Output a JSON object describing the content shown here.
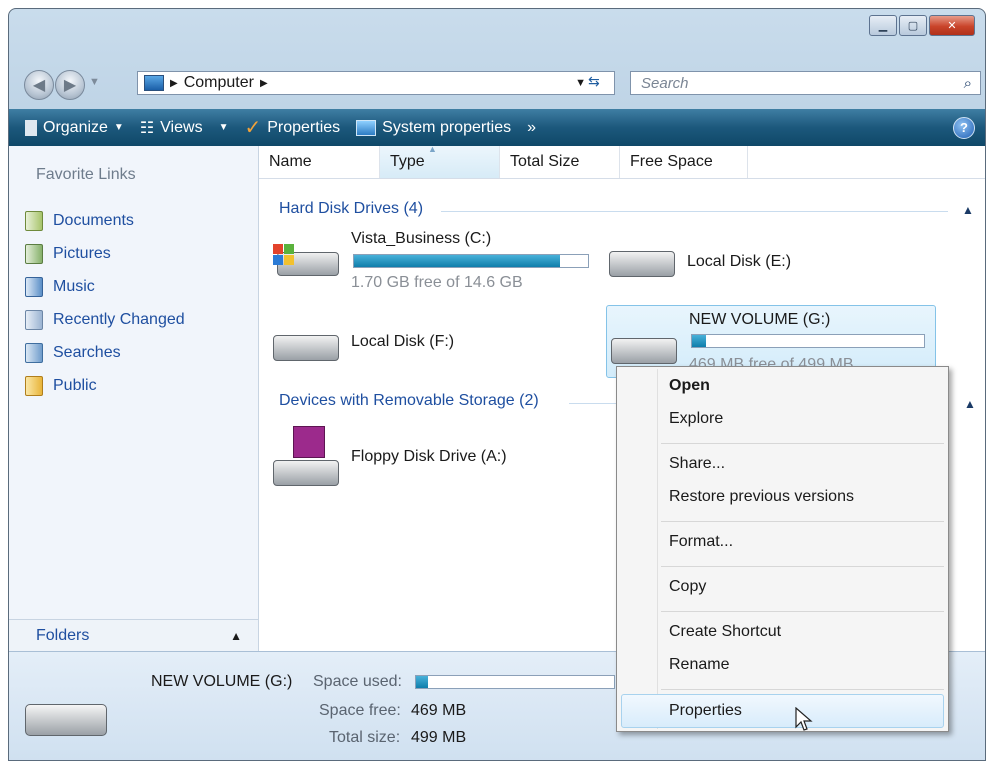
{
  "window": {
    "caption_buttons": [
      "minimize",
      "maximize",
      "close"
    ]
  },
  "address": {
    "crumbs": [
      "Computer"
    ],
    "search_placeholder": "Search"
  },
  "toolbar": {
    "organize": "Organize",
    "views": "Views",
    "properties": "Properties",
    "system_properties": "System properties",
    "overflow": "»",
    "help": "?"
  },
  "nav": {
    "title": "Favorite Links",
    "links": [
      "Documents",
      "Pictures",
      "Music",
      "Recently Changed",
      "Searches",
      "Public"
    ],
    "folders": "Folders"
  },
  "columns": [
    "Name",
    "Type",
    "Total Size",
    "Free Space"
  ],
  "groups": {
    "hdd": "Hard Disk Drives (4)",
    "removable": "Devices with Removable Storage (2)"
  },
  "drives": {
    "c": {
      "name": "Vista_Business (C:)",
      "info": "1.70 GB free of 14.6 GB",
      "used_fraction": 0.88
    },
    "e": {
      "name": "Local Disk (E:)"
    },
    "f": {
      "name": "Local Disk (F:)"
    },
    "g": {
      "name": "NEW VOLUME (G:)",
      "info": "469 MB free of 499 MB",
      "used_fraction": 0.06
    },
    "a": {
      "name": "Floppy Disk Drive (A:)"
    }
  },
  "details": {
    "name": "NEW VOLUME (G:)",
    "space_used_label": "Space used:",
    "space_free_label": "Space free:",
    "space_free": "469 MB",
    "total_size_label": "Total size:",
    "total_size": "499 MB",
    "used_fraction": 0.06
  },
  "context_menu": {
    "open": "Open",
    "explore": "Explore",
    "share": "Share...",
    "restore": "Restore previous versions",
    "format": "Format...",
    "copy": "Copy",
    "create_shortcut": "Create Shortcut",
    "rename": "Rename",
    "properties": "Properties"
  },
  "colors": {
    "accent": "#1f4fa0",
    "toolbar": "#1c587c",
    "bar": "#0f7eab"
  }
}
